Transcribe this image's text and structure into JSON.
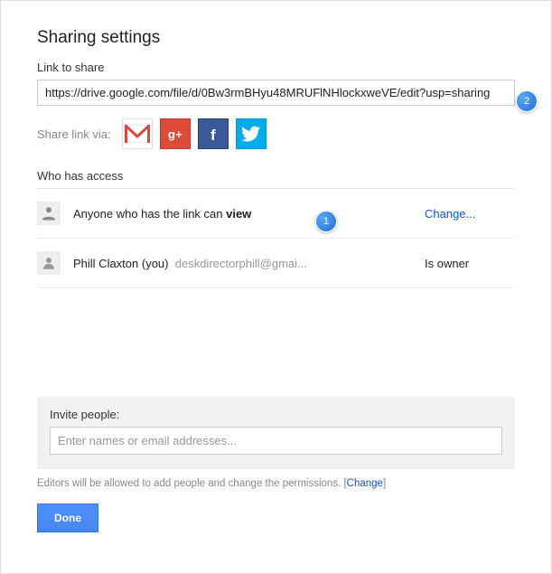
{
  "title": "Sharing settings",
  "linkSection": {
    "label": "Link to share",
    "url": "https://drive.google.com/file/d/0Bw3rmBHyu48MRUFlNHlockxweVE/edit?usp=sharing"
  },
  "shareVia": {
    "label": "Share link via:",
    "services": [
      "gmail",
      "google-plus",
      "facebook",
      "twitter"
    ]
  },
  "accessSection": {
    "heading": "Who has access",
    "rows": [
      {
        "text_prefix": "Anyone who has the link can ",
        "text_bold": "view",
        "action": "Change...",
        "role": ""
      },
      {
        "name": "Phill Claxton (you)",
        "email": "deskdirectorphill@gmai...",
        "action": "",
        "role": "Is owner"
      }
    ]
  },
  "invite": {
    "label": "Invite people:",
    "placeholder": "Enter names or email addresses..."
  },
  "editorNote": {
    "text": "Editors will be allowed to add people and change the permissions.  [",
    "link": "Change",
    "closing": "]"
  },
  "doneLabel": "Done",
  "annotations": {
    "badge1": "1",
    "badge2": "2"
  }
}
